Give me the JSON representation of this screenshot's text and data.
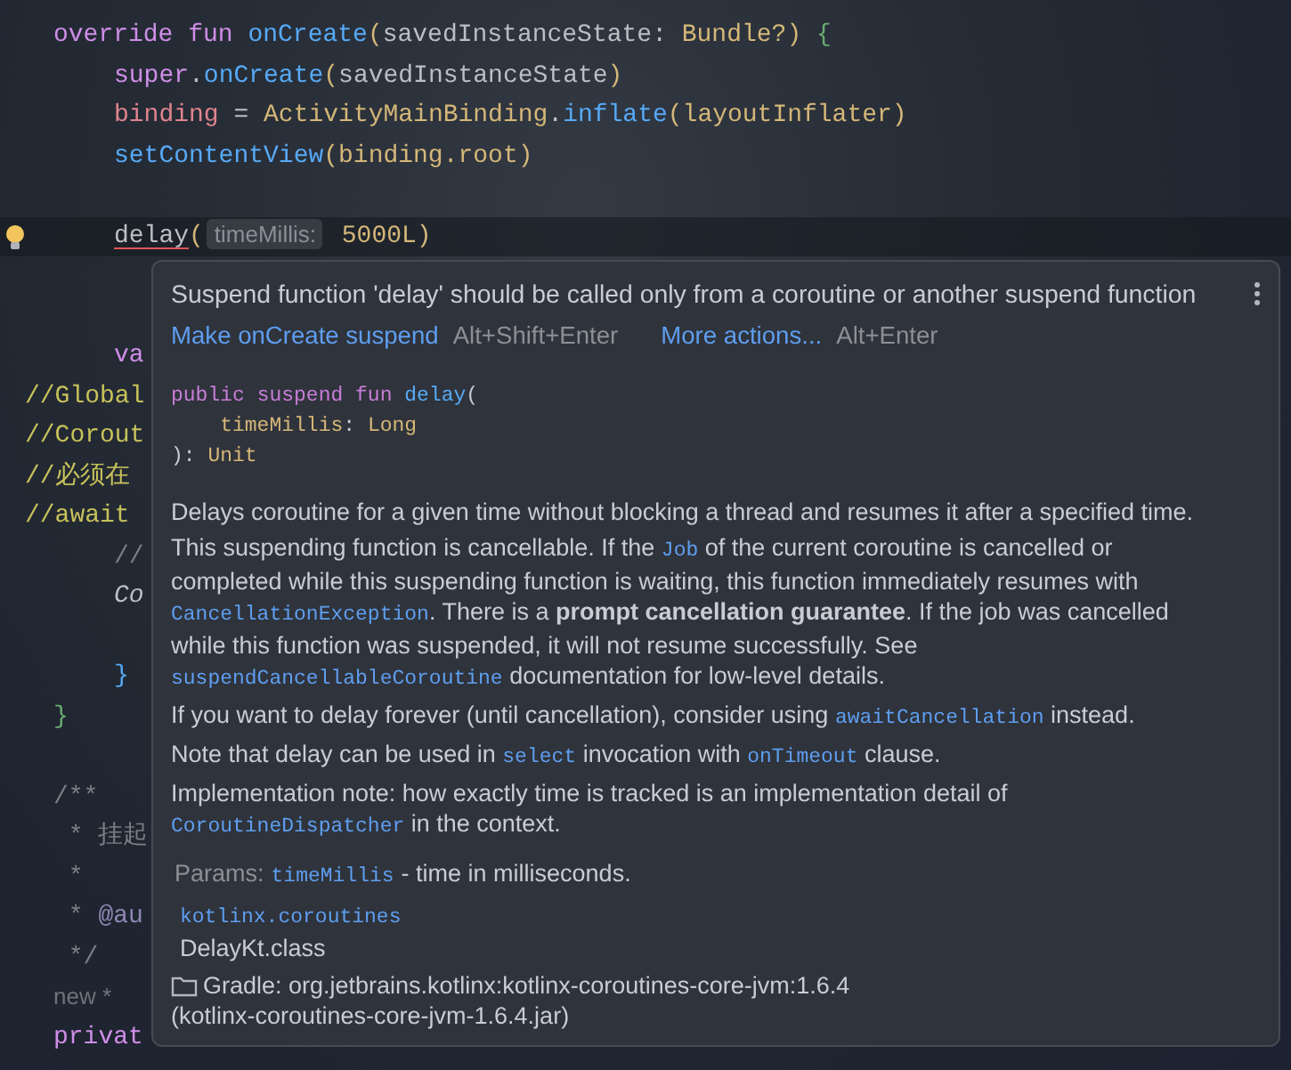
{
  "editor": {
    "lines": [
      {
        "kind": "code",
        "tokens": [
          {
            "text": "override fun ",
            "kind": "keyword"
          },
          {
            "text": "onCreate",
            "kind": "fn"
          },
          {
            "text": "(",
            "kind": "type"
          },
          {
            "text": "savedInstanceState: ",
            "kind": "plain"
          },
          {
            "text": "Bundle?",
            "kind": "type"
          },
          {
            "text": ") ",
            "kind": "type"
          },
          {
            "text": "{",
            "kind": "brace-green"
          }
        ],
        "children": [
          {
            "kind": "code",
            "tokens": [
              {
                "text": "super",
                "kind": "keyword"
              },
              {
                "text": ".",
                "kind": "plain"
              },
              {
                "text": "onCreate",
                "kind": "fn"
              },
              {
                "text": "(",
                "kind": "type"
              },
              {
                "text": "savedInstanceState",
                "kind": "plain"
              },
              {
                "text": ")",
                "kind": "type"
              }
            ]
          },
          {
            "kind": "code",
            "tokens": [
              {
                "text": "binding",
                "kind": "prop"
              },
              {
                "text": " = ",
                "kind": "plain"
              },
              {
                "text": "ActivityMainBinding",
                "kind": "type"
              },
              {
                "text": ".",
                "kind": "plain"
              },
              {
                "text": "inflate",
                "kind": "fn"
              },
              {
                "text": "(layoutInflater)",
                "kind": "type"
              }
            ]
          },
          {
            "kind": "code",
            "tokens": [
              {
                "text": "setContentView",
                "kind": "fn"
              },
              {
                "text": "(binding.root)",
                "kind": "type"
              }
            ]
          },
          {
            "kind": "blank"
          },
          {
            "kind": "code",
            "current": true,
            "intention": true,
            "tokens": [
              {
                "text": "delay",
                "kind": "error"
              },
              {
                "text": "(",
                "kind": "type"
              },
              {
                "text": "timeMillis:",
                "kind": "hint"
              },
              {
                "text": " 5000L",
                "kind": "type"
              },
              {
                "text": ")",
                "kind": "type"
              }
            ]
          },
          {
            "kind": "blank"
          },
          {
            "kind": "blank"
          },
          {
            "kind": "code",
            "tokens": [
              {
                "text": "va",
                "kind": "keyword"
              }
            ]
          }
        ]
      },
      {
        "kind": "stray",
        "tokens": [
          {
            "text": "//Global",
            "kind": "comment"
          }
        ]
      },
      {
        "kind": "stray",
        "tokens": [
          {
            "text": "//Corout",
            "kind": "comment"
          }
        ]
      },
      {
        "kind": "stray",
        "tokens": [
          {
            "text": "//必须在",
            "kind": "comment"
          }
        ]
      },
      {
        "kind": "stray",
        "tokens": [
          {
            "text": "//await",
            "kind": "comment"
          }
        ]
      },
      {
        "kind": "group",
        "children": [
          {
            "kind": "code",
            "tokens": [
              {
                "text": "//",
                "kind": "doc"
              }
            ]
          },
          {
            "kind": "code",
            "tokens": [
              {
                "text": "Co",
                "kind": "italic"
              }
            ]
          },
          {
            "kind": "blank"
          },
          {
            "kind": "code",
            "tokens": [
              {
                "text": "}",
                "kind": "brace-blue"
              }
            ]
          }
        ]
      },
      {
        "kind": "code",
        "tokens": [
          {
            "text": "}",
            "kind": "brace-green"
          }
        ]
      },
      {
        "kind": "blank"
      },
      {
        "kind": "code",
        "tokens": [
          {
            "text": "/**",
            "kind": "doc"
          }
        ]
      },
      {
        "kind": "doc-body",
        "tokens": [
          {
            "text": "* 挂起",
            "kind": "doc"
          }
        ]
      },
      {
        "kind": "doc-body",
        "tokens": [
          {
            "text": "*",
            "kind": "doc"
          }
        ]
      },
      {
        "kind": "doc-body",
        "tokens": [
          {
            "text": "* ",
            "kind": "doc"
          },
          {
            "text": "@au",
            "kind": "doctag"
          }
        ]
      },
      {
        "kind": "doc-body",
        "tokens": [
          {
            "text": "*/",
            "kind": "doc"
          }
        ]
      },
      {
        "kind": "code",
        "tokens": [
          {
            "text": "new *",
            "kind": "inlay"
          }
        ]
      },
      {
        "kind": "code",
        "tokens": [
          {
            "text": "privat",
            "kind": "keyword"
          }
        ]
      }
    ]
  },
  "popup": {
    "message": "Suspend function 'delay' should be called only from a coroutine or another suspend function",
    "actions": [
      {
        "label": "Make onCreate suspend",
        "shortcut": "Alt+Shift+Enter"
      },
      {
        "label": "More actions...",
        "shortcut": "Alt+Enter"
      }
    ],
    "signature": [
      [
        {
          "text": "public ",
          "kind": "keyword"
        },
        {
          "text": "suspend ",
          "kind": "keyword"
        },
        {
          "text": "fun ",
          "kind": "keyword"
        },
        {
          "text": "delay",
          "kind": "fn"
        },
        {
          "text": "(",
          "kind": "plain"
        }
      ],
      [
        {
          "text": "    timeMillis",
          "kind": "type"
        },
        {
          "text": ": ",
          "kind": "plain"
        },
        {
          "text": "Long",
          "kind": "type"
        }
      ],
      [
        {
          "text": "): ",
          "kind": "plain"
        },
        {
          "text": "Unit",
          "kind": "type"
        }
      ]
    ],
    "description": [
      [
        {
          "kind": "text",
          "text": "Delays coroutine for a given time without blocking a thread and resumes it after a specified time."
        }
      ],
      [
        {
          "kind": "text",
          "text": "This suspending function is cancellable. If the "
        },
        {
          "kind": "code",
          "text": "Job"
        },
        {
          "kind": "text",
          "text": " of the current coroutine is cancelled or completed while this suspending function is waiting, this function immediately resumes with "
        },
        {
          "kind": "code",
          "text": "CancellationException"
        },
        {
          "kind": "text",
          "text": ". There is a **prompt cancellation guarantee**. If the job was cancelled while this function was suspended, it will not resume successfully. See "
        },
        {
          "kind": "code",
          "text": "suspendCancellableCoroutine"
        },
        {
          "kind": "text",
          "text": " documentation for low-level details."
        }
      ],
      [
        {
          "kind": "text",
          "text": "If you want to delay forever (until cancellation), consider using "
        },
        {
          "kind": "code",
          "text": "awaitCancellation"
        },
        {
          "kind": "text",
          "text": " instead."
        }
      ],
      [
        {
          "kind": "text",
          "text": "Note that delay can be used in "
        },
        {
          "kind": "code",
          "text": "select"
        },
        {
          "kind": "text",
          "text": " invocation with "
        },
        {
          "kind": "code",
          "text": "onTimeout"
        },
        {
          "kind": "text",
          "text": " clause."
        }
      ],
      [
        {
          "kind": "text",
          "text": "Implementation note: how exactly time is tracked is an implementation detail of "
        },
        {
          "kind": "code",
          "text": "CoroutineDispatcher"
        },
        {
          "kind": "text",
          "text": " in the context."
        }
      ]
    ],
    "params": {
      "label": "Params:",
      "name": "timeMillis",
      "text": "- time in milliseconds."
    },
    "location": {
      "package": "kotlinx.coroutines",
      "file": "DelayKt.class"
    },
    "library": {
      "name": "Gradle: org.jetbrains.kotlinx:kotlinx-coroutines-core-jvm:1.6.4",
      "jar": "(kotlinx-coroutines-core-jvm-1.6.4.jar)"
    }
  }
}
